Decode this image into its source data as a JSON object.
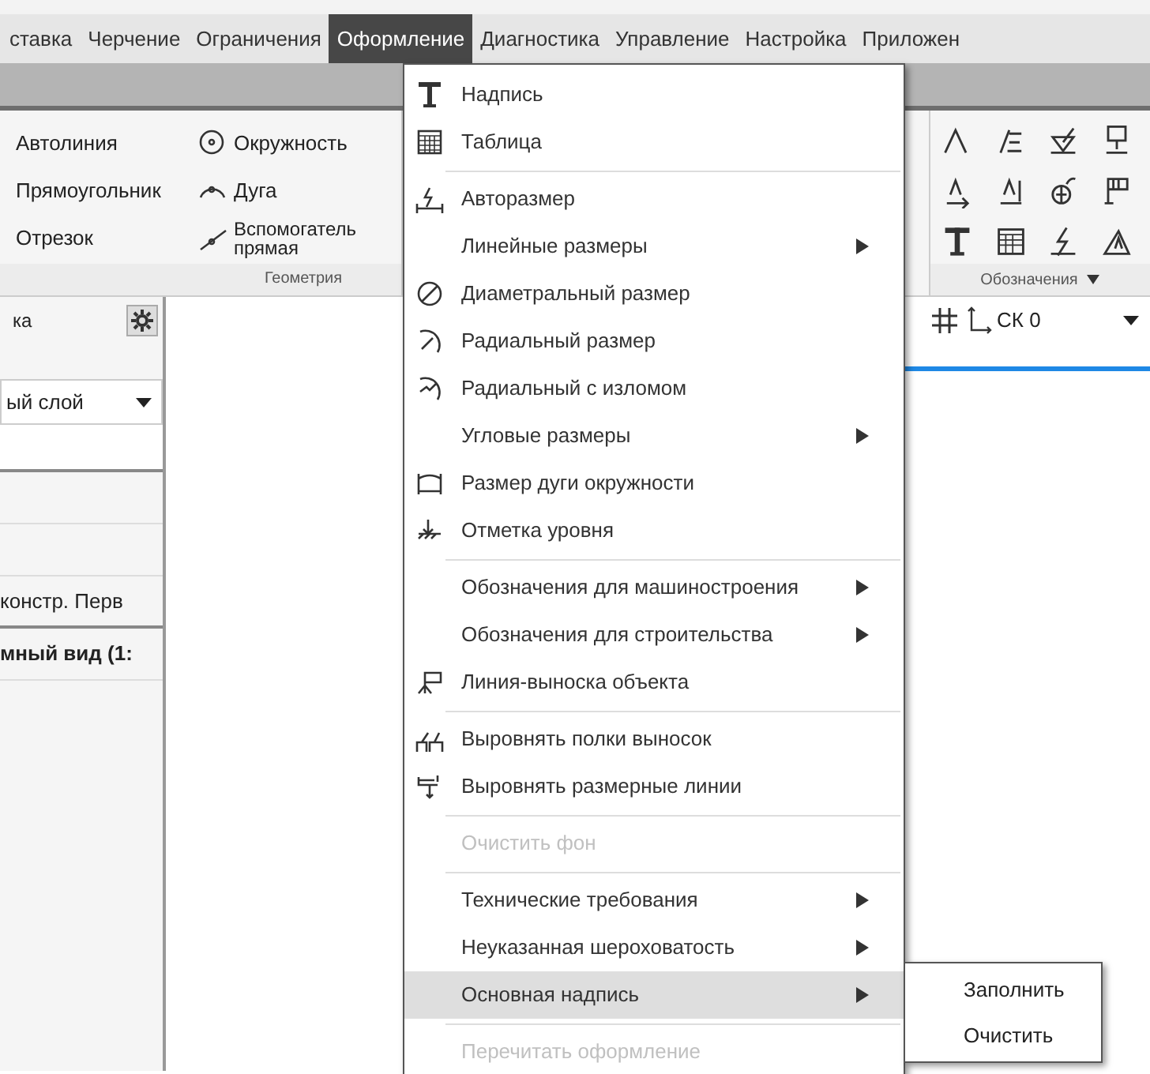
{
  "menu_bar": [
    {
      "label": "ставка",
      "selected": false
    },
    {
      "label": "Черчение",
      "selected": false
    },
    {
      "label": "Ограничения",
      "selected": false
    },
    {
      "label": "Оформление",
      "selected": true
    },
    {
      "label": "Диагностика",
      "selected": false
    },
    {
      "label": "Управление",
      "selected": false
    },
    {
      "label": "Настройка",
      "selected": false
    },
    {
      "label": "Приложен",
      "selected": false
    }
  ],
  "ribbon": {
    "geometry": {
      "label": "Геометрия",
      "commands": [
        {
          "label": "Автолиния"
        },
        {
          "label": "Прямоугольник"
        },
        {
          "label": "Отрезок"
        }
      ],
      "tools": [
        {
          "label": "Окружность"
        },
        {
          "label": "Дуга"
        },
        {
          "label": "Вспомогатель\nпрямая"
        }
      ]
    },
    "symbols": {
      "label": "Обозначения"
    }
  },
  "toolbar": {
    "coordinate_system": "СК 0"
  },
  "left_panel": {
    "title": "ка",
    "layer": "ый слой",
    "rows": [
      {
        "label": "констр. Перв",
        "bold": false
      },
      {
        "label": "мный вид (1:",
        "bold": true
      }
    ]
  },
  "menu": {
    "items": [
      {
        "kind": "item",
        "label": "Надпись",
        "submenu": false,
        "disabled": false,
        "selected": false
      },
      {
        "kind": "item",
        "label": "Таблица",
        "submenu": false,
        "disabled": false,
        "selected": false
      },
      {
        "kind": "separator"
      },
      {
        "kind": "item",
        "label": "Авторазмер",
        "submenu": false,
        "disabled": false,
        "selected": false
      },
      {
        "kind": "item",
        "label": "Линейные размеры",
        "submenu": true,
        "disabled": false,
        "selected": false
      },
      {
        "kind": "item",
        "label": "Диаметральный размер",
        "submenu": false,
        "disabled": false,
        "selected": false
      },
      {
        "kind": "item",
        "label": "Радиальный размер",
        "submenu": false,
        "disabled": false,
        "selected": false
      },
      {
        "kind": "item",
        "label": "Радиальный с изломом",
        "submenu": false,
        "disabled": false,
        "selected": false
      },
      {
        "kind": "item",
        "label": "Угловые размеры",
        "submenu": true,
        "disabled": false,
        "selected": false
      },
      {
        "kind": "item",
        "label": "Размер дуги окружности",
        "submenu": false,
        "disabled": false,
        "selected": false
      },
      {
        "kind": "item",
        "label": "Отметка уровня",
        "submenu": false,
        "disabled": false,
        "selected": false
      },
      {
        "kind": "separator"
      },
      {
        "kind": "item",
        "label": "Обозначения для машиностроения",
        "submenu": true,
        "disabled": false,
        "selected": false
      },
      {
        "kind": "item",
        "label": "Обозначения для строительства",
        "submenu": true,
        "disabled": false,
        "selected": false
      },
      {
        "kind": "item",
        "label": "Линия-выноска объекта",
        "submenu": false,
        "disabled": false,
        "selected": false
      },
      {
        "kind": "separator"
      },
      {
        "kind": "item",
        "label": "Выровнять полки выносок",
        "submenu": false,
        "disabled": false,
        "selected": false
      },
      {
        "kind": "item",
        "label": "Выровнять размерные линии",
        "submenu": false,
        "disabled": false,
        "selected": false
      },
      {
        "kind": "separator"
      },
      {
        "kind": "item",
        "label": "Очистить фон",
        "submenu": false,
        "disabled": true,
        "selected": false
      },
      {
        "kind": "separator"
      },
      {
        "kind": "item",
        "label": "Технические требования",
        "submenu": true,
        "disabled": false,
        "selected": false
      },
      {
        "kind": "item",
        "label": "Неуказанная шероховатость",
        "submenu": true,
        "disabled": false,
        "selected": false
      },
      {
        "kind": "item",
        "label": "Основная надпись",
        "submenu": true,
        "disabled": false,
        "selected": true
      },
      {
        "kind": "separator"
      },
      {
        "kind": "item",
        "label": "Перечитать оформление",
        "submenu": false,
        "disabled": true,
        "selected": false
      }
    ],
    "submenu": {
      "items": [
        {
          "label": "Заполнить"
        },
        {
          "label": "Очистить"
        }
      ]
    }
  }
}
